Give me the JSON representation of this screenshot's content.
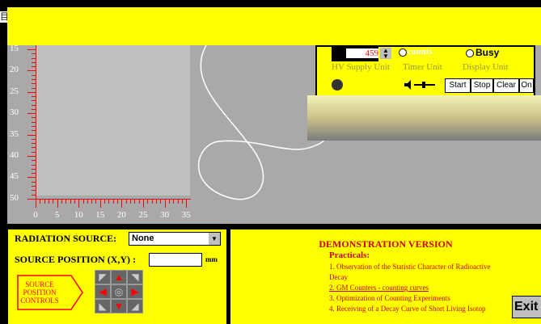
{
  "window": {
    "edge_glyph": "目"
  },
  "axis_y": {
    "ticks": [
      "15",
      "20",
      "25",
      "30",
      "35",
      "40",
      "45",
      "50"
    ]
  },
  "axis_x": {
    "ticks": [
      "0",
      "5",
      "10",
      "15",
      "20",
      "25",
      "30",
      "35"
    ]
  },
  "device": {
    "counter_value": "459",
    "counts_label": "counts",
    "busy_label": "Busy",
    "hv_supply": "HV Supply Unit",
    "timer": "Timer Unit",
    "display": "Display Unit",
    "buttons": {
      "start": "Start",
      "stop": "Stop",
      "clear": "Clear",
      "on": "On"
    }
  },
  "controls": {
    "source_label": "RADIATION SOURCE:",
    "source_value": "None",
    "position_label": "SOURCE POSITION (X,Y) :",
    "position_value": "",
    "unit": "mm",
    "source_controls": [
      "SOURCE",
      "POSITION",
      "CONTROLS"
    ]
  },
  "demo": {
    "title": "DEMONSTRATION VERSION",
    "practicals_label": "Practicals:",
    "items": [
      "1. Observation of the Statistic Character of Radioactive",
      "Decay",
      "2. GM Counters - counting curves",
      "3. Optimization of Counting Experiments",
      "4. Receiving of a Decay Curve of Short Living Isotop"
    ]
  },
  "exit_label": "Exit",
  "colors": {
    "banner": "#ffff00",
    "tube": "#c0c0c0",
    "lab": "#a9a9a9",
    "accent_red": "#cc0000"
  }
}
